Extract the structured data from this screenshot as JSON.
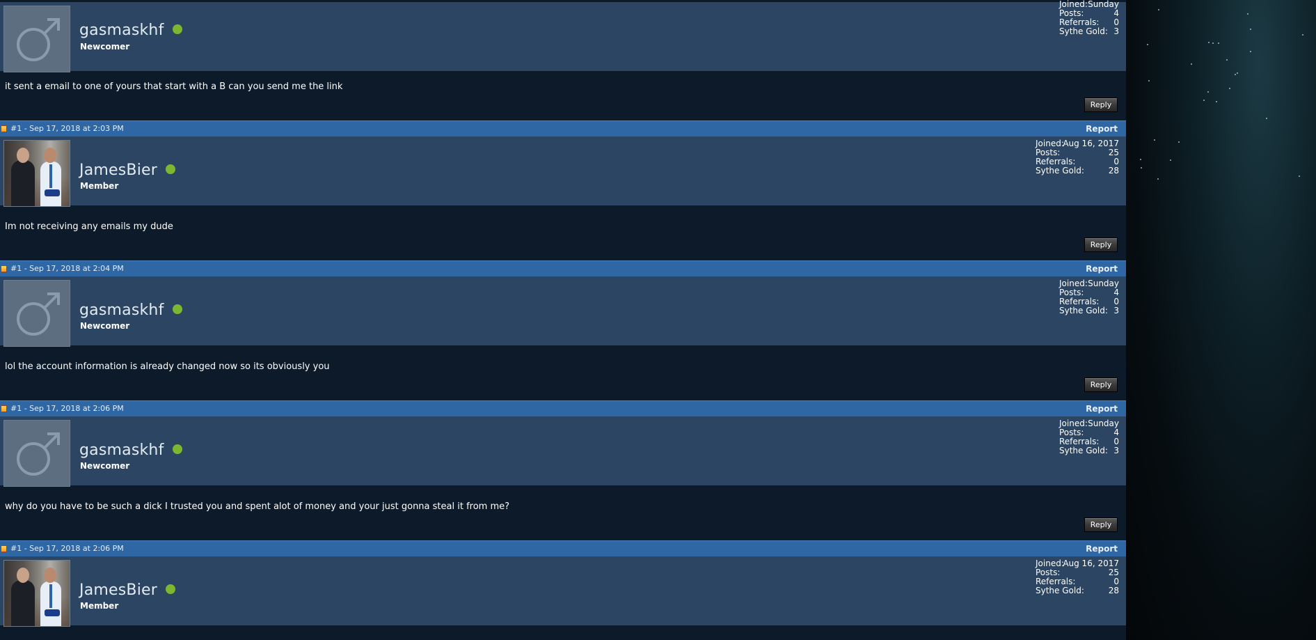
{
  "posts": [
    {
      "username": "gasmaskhf",
      "rank": "Newcomer",
      "avatar_icon": "male-symbol-icon",
      "stats": [
        {
          "label": "Joined:",
          "value": "Sunday"
        },
        {
          "label": "Posts:",
          "value": "4"
        },
        {
          "label": "Referrals:",
          "value": "0"
        },
        {
          "label": "Sythe Gold:",
          "value": "3"
        }
      ],
      "message": "it sent a email to one of yours that start with a B can you send me the link",
      "reply_label": "Reply"
    },
    {
      "meta": "#1 - Sep 17, 2018 at 2:03 PM",
      "report_label": "Report",
      "username": "JamesBier",
      "rank": "Member",
      "stats": [
        {
          "label": "Joined:",
          "value": "Aug 16, 2017"
        },
        {
          "label": "Posts:",
          "value": "25"
        },
        {
          "label": "Referrals:",
          "value": "0"
        },
        {
          "label": "Sythe Gold:",
          "value": "28"
        }
      ],
      "message": "Im not receiving any emails my dude",
      "reply_label": "Reply"
    },
    {
      "meta": "#1 - Sep 17, 2018 at 2:04 PM",
      "report_label": "Report",
      "username": "gasmaskhf",
      "rank": "Newcomer",
      "stats": [
        {
          "label": "Joined:",
          "value": "Sunday"
        },
        {
          "label": "Posts:",
          "value": "4"
        },
        {
          "label": "Referrals:",
          "value": "0"
        },
        {
          "label": "Sythe Gold:",
          "value": "3"
        }
      ],
      "message": "lol the account information is already changed now so its obviously you",
      "reply_label": "Reply"
    },
    {
      "meta": "#1 - Sep 17, 2018 at 2:06 PM",
      "report_label": "Report",
      "username": "gasmaskhf",
      "rank": "Newcomer",
      "stats": [
        {
          "label": "Joined:",
          "value": "Sunday"
        },
        {
          "label": "Posts:",
          "value": "4"
        },
        {
          "label": "Referrals:",
          "value": "0"
        },
        {
          "label": "Sythe Gold:",
          "value": "3"
        }
      ],
      "message": "why do you have to be such a dick I trusted you and spent alot of money and your just gonna steal it from me?",
      "reply_label": "Reply"
    },
    {
      "meta": "#1 - Sep 17, 2018 at 2:06 PM",
      "report_label": "Report",
      "username": "JamesBier",
      "rank": "Member",
      "stats": [
        {
          "label": "Joined:",
          "value": "Aug 16, 2017"
        },
        {
          "label": "Posts:",
          "value": "25"
        },
        {
          "label": "Referrals:",
          "value": "0"
        },
        {
          "label": "Sythe Gold:",
          "value": "28"
        }
      ]
    }
  ],
  "colors": {
    "userbar": "#2c4562",
    "postbar": "#2f66a4",
    "message_bg": "#0c1a2a",
    "online_dot": "#7cb82f"
  }
}
